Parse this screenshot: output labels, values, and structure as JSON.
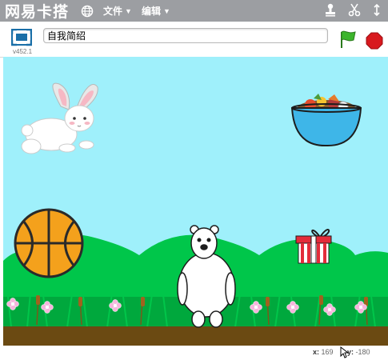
{
  "app": {
    "logo": "网易卡搭"
  },
  "menus": [
    {
      "label": "文件",
      "icon": "chevron-down-icon"
    },
    {
      "label": "编辑",
      "icon": "chevron-down-icon"
    }
  ],
  "toolbar": {
    "version": "v452.1",
    "project_title": "自我简绍",
    "icons": [
      "globe-icon",
      "stamp-icon",
      "scissors-icon",
      "presentation-icon",
      "green-flag-icon",
      "stop-icon"
    ]
  },
  "stage": {
    "sprites": [
      "rabbit",
      "fruit-bowl",
      "basketball",
      "gift-box",
      "polar-bear"
    ],
    "backdrop": "grassy hills with flowers"
  },
  "status": {
    "x_label": "x:",
    "x_value": "169",
    "y_label": "y:",
    "y_value": "-180"
  },
  "colors": {
    "menubar": "#9c9ea2",
    "sky": "#9ff0fb",
    "grass": "#00c64a",
    "ground": "#6b4a12",
    "accent_blue": "#1a6fa8"
  }
}
